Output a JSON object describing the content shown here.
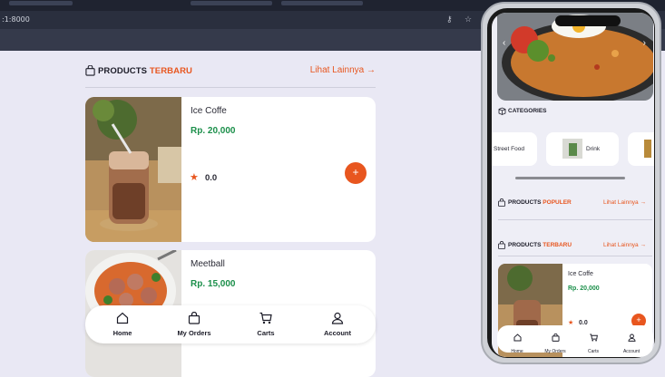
{
  "browser": {
    "address": ":1:8000"
  },
  "products_section": {
    "title_prefix": "PRODUCTS",
    "title_accent": "TERBARU",
    "see_more": "Lihat Lainnya →"
  },
  "products": [
    {
      "name": "Ice Coffe",
      "price": "Rp. 20,000",
      "rating": "0.0",
      "add": "+"
    },
    {
      "name": "Meetball",
      "price": "Rp. 15,000"
    }
  ],
  "bottom_nav": [
    {
      "label": "Home",
      "icon": "home-icon"
    },
    {
      "label": "My Orders",
      "icon": "bag-icon"
    },
    {
      "label": "Carts",
      "icon": "cart-icon"
    },
    {
      "label": "Account",
      "icon": "user-icon"
    }
  ],
  "phone": {
    "categories_title": "CATEGORIES",
    "categories": [
      "Street Food",
      "Drink"
    ],
    "populer": {
      "prefix": "PRODUCTS",
      "accent": "POPULER",
      "see_more": "Lihat Lainnya →"
    },
    "terbaru": {
      "prefix": "PRODUCTS",
      "accent": "TERBARU",
      "see_more": "Lihat Lainnya →"
    },
    "product": {
      "name": "Ice Coffe",
      "price": "Rp. 20,000",
      "rating": "0.0"
    },
    "nav": [
      "Home",
      "My Orders",
      "Carts",
      "Account"
    ]
  },
  "colors": {
    "accent": "#e8561f",
    "price": "#1b8f4a",
    "background": "#e9e8f4"
  }
}
